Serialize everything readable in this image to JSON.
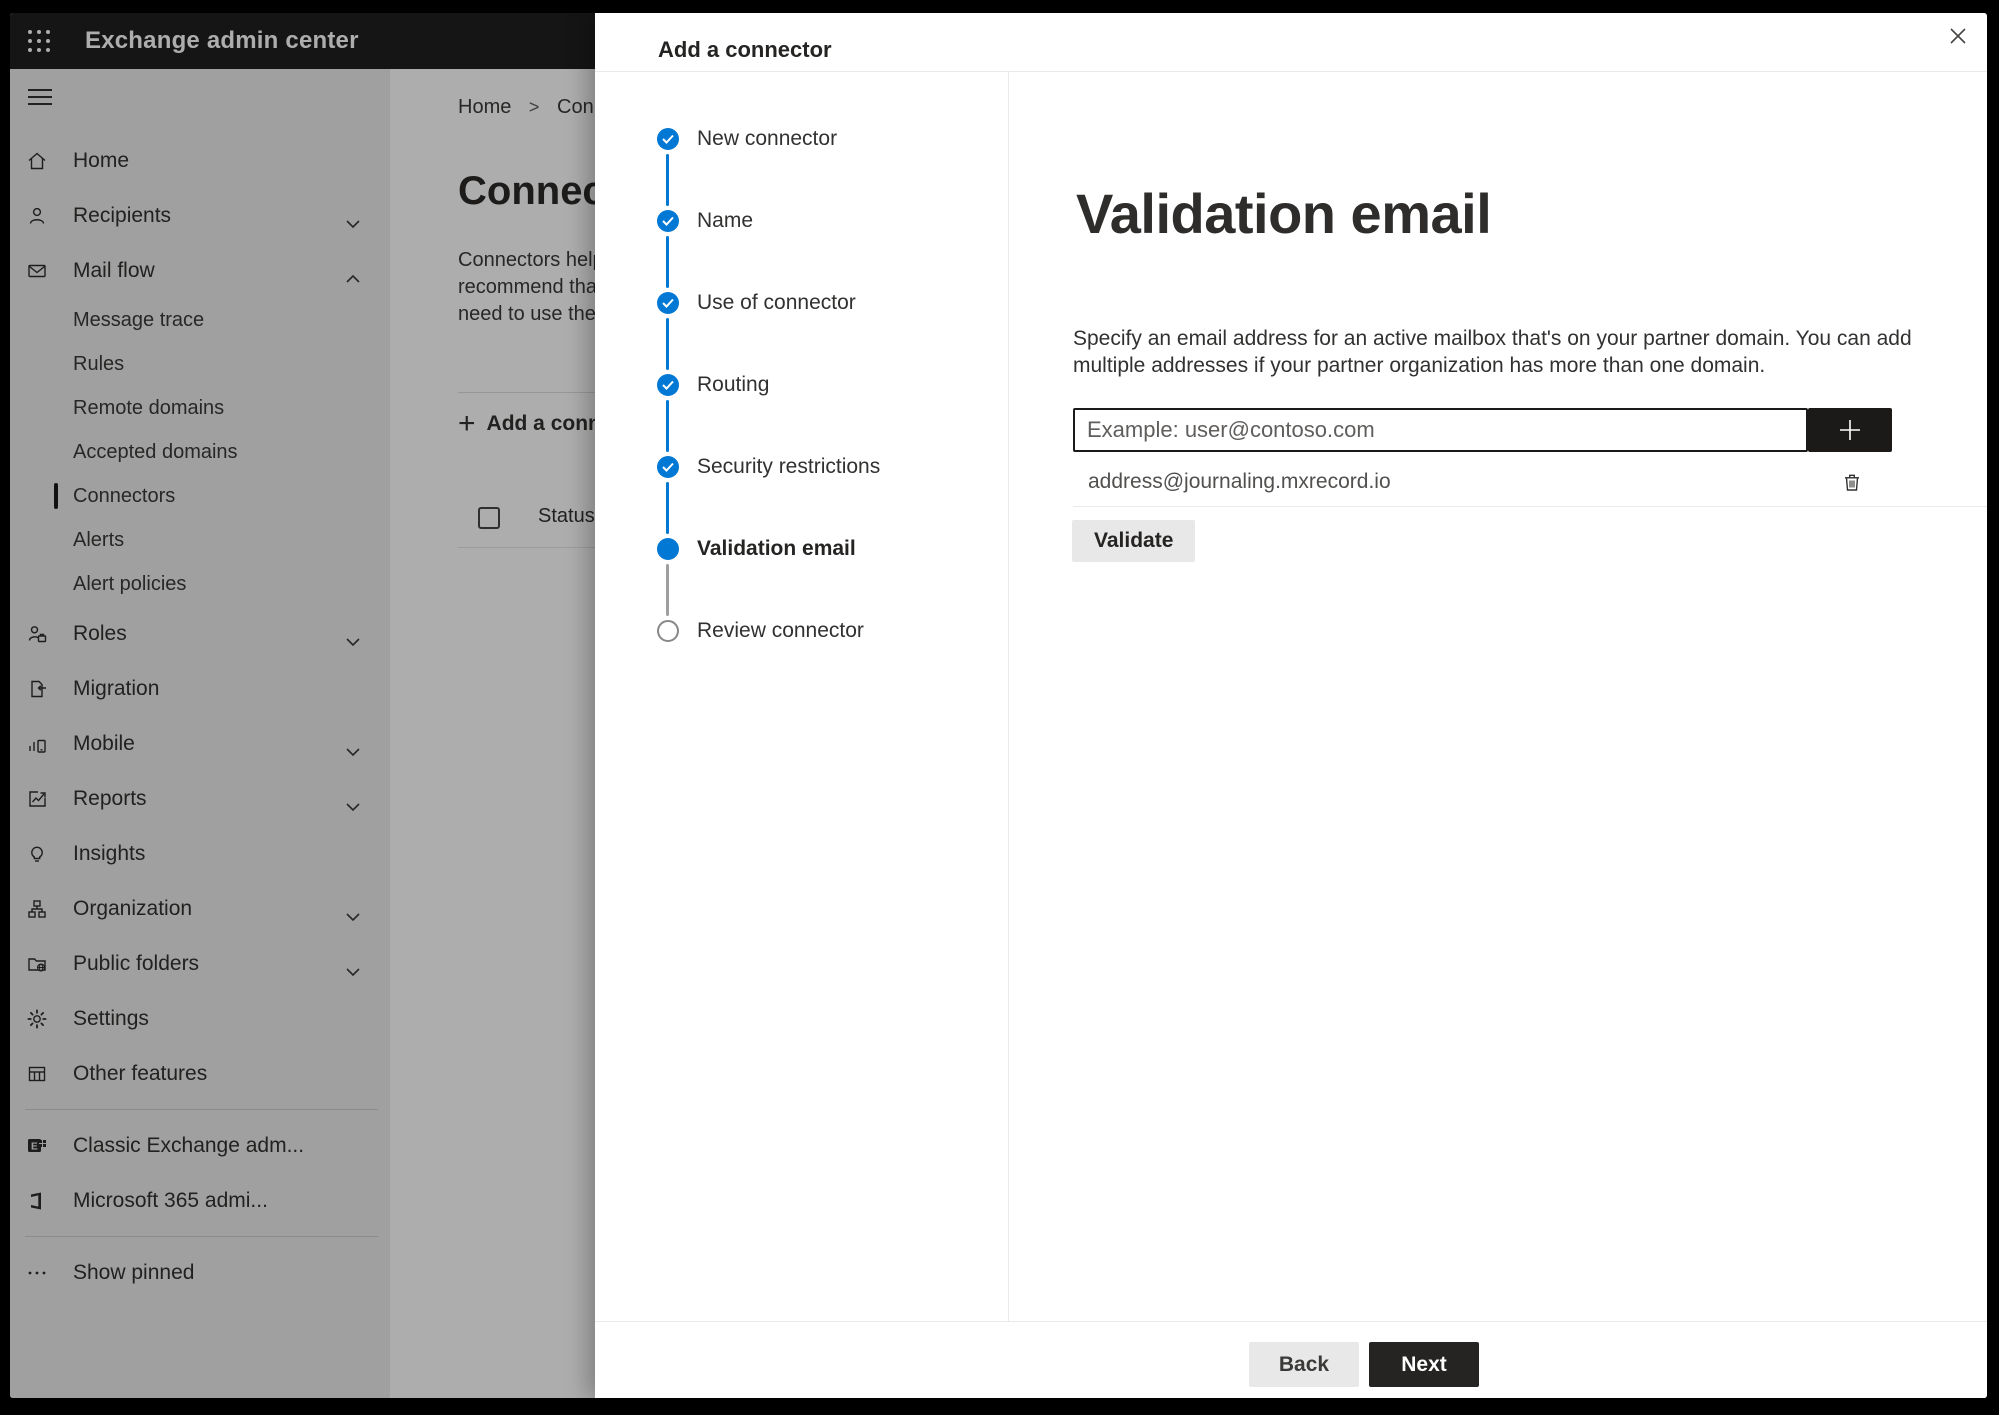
{
  "topbar": {
    "title": "Exchange admin center"
  },
  "sidebar": {
    "items": [
      {
        "label": "Home",
        "icon": "home-icon"
      },
      {
        "label": "Recipients",
        "icon": "person-icon",
        "chevron": "down"
      },
      {
        "label": "Mail flow",
        "icon": "mail-icon",
        "chevron": "up",
        "expanded": true,
        "children": [
          {
            "label": "Message trace"
          },
          {
            "label": "Rules"
          },
          {
            "label": "Remote domains"
          },
          {
            "label": "Accepted domains"
          },
          {
            "label": "Connectors",
            "selected": true
          },
          {
            "label": "Alerts"
          },
          {
            "label": "Alert policies"
          }
        ]
      },
      {
        "label": "Roles",
        "icon": "roles-icon",
        "chevron": "down"
      },
      {
        "label": "Migration",
        "icon": "migration-icon"
      },
      {
        "label": "Mobile",
        "icon": "mobile-icon",
        "chevron": "down"
      },
      {
        "label": "Reports",
        "icon": "reports-icon",
        "chevron": "down"
      },
      {
        "label": "Insights",
        "icon": "insights-icon"
      },
      {
        "label": "Organization",
        "icon": "organization-icon",
        "chevron": "down"
      },
      {
        "label": "Public folders",
        "icon": "public-folders-icon",
        "chevron": "down"
      },
      {
        "label": "Settings",
        "icon": "settings-icon"
      },
      {
        "label": "Other features",
        "icon": "other-features-icon"
      }
    ],
    "footer_items": [
      {
        "label": "Classic Exchange adm...",
        "icon": "exchange-logo-icon"
      },
      {
        "label": "Microsoft 365 admi...",
        "icon": "office-logo-icon"
      }
    ],
    "show_pinned": {
      "label": "Show pinned",
      "icon": "ellipsis-icon"
    }
  },
  "page": {
    "breadcrumb": {
      "home": "Home",
      "separator": ">",
      "current": "Connectors"
    },
    "title": "Connectors",
    "description_lines": [
      "Connectors help",
      "recommend that",
      "need to use ther"
    ],
    "add_button_label": "Add a connector",
    "table": {
      "status_header": "Status"
    }
  },
  "dialog": {
    "title": "Add a connector",
    "steps": [
      {
        "label": "New connector",
        "state": "complete"
      },
      {
        "label": "Name",
        "state": "complete"
      },
      {
        "label": "Use of connector",
        "state": "complete"
      },
      {
        "label": "Routing",
        "state": "complete"
      },
      {
        "label": "Security restrictions",
        "state": "complete"
      },
      {
        "label": "Validation email",
        "state": "current"
      },
      {
        "label": "Review connector",
        "state": "upcoming"
      }
    ],
    "validation": {
      "heading": "Validation email",
      "description_lines": [
        "Specify an email address for an active mailbox that's on your partner domain. You can add",
        "multiple addresses if your partner organization has more than one domain."
      ],
      "email_input": {
        "value": "",
        "placeholder": "Example: user@contoso.com"
      },
      "addresses": [
        {
          "email": "address@journaling.mxrecord.io"
        }
      ],
      "validate_button_label": "Validate"
    },
    "footer": {
      "back_label": "Back",
      "next_label": "Next"
    }
  },
  "colors": {
    "accent_blue": "#0078d4",
    "dark_button": "#1b1a19",
    "step_line_gray": "#a19f9d",
    "overlay": "rgba(0,0,0,0.32)"
  }
}
